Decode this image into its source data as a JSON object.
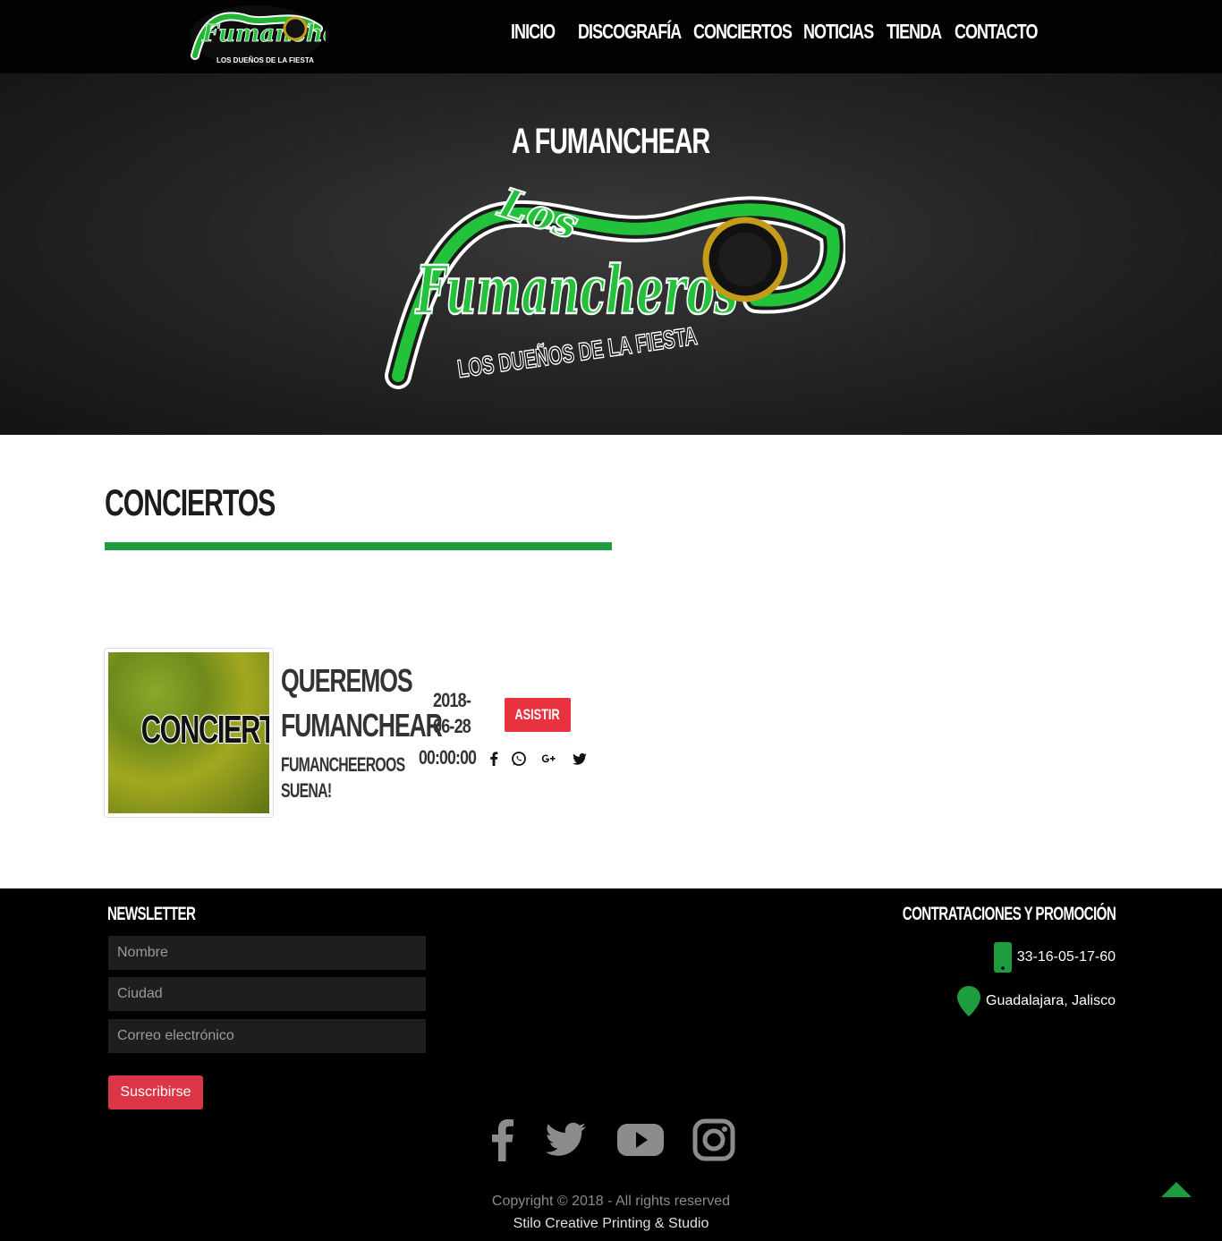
{
  "nav": {
    "items": [
      {
        "label": "INICIO"
      },
      {
        "label": "DISCOGRAFÍA"
      },
      {
        "label": "CONCIERTOS"
      },
      {
        "label": "NOTICIAS"
      },
      {
        "label": "TIENDA"
      },
      {
        "label": "CONTACTO"
      }
    ]
  },
  "brand": {
    "logo_line1": "Los",
    "logo_line2": "Fumancheros",
    "tagline": "LOS DUEÑOS DE LA FIESTA"
  },
  "hero": {
    "title": "A FUMANCHEAR"
  },
  "section": {
    "title": "CONCIERTOS"
  },
  "concert": {
    "thumb_label": "CONCIERTO",
    "title_line1": "QUEREMOS",
    "title_line2": "FUMANCHEAR",
    "subtitle_line1": "FUMANCHEEROOS",
    "subtitle_line2": "SUENA!",
    "date_line1": "2018-",
    "date_line2": "06-28",
    "time": "00:00:00",
    "button": "ASISTIR",
    "share_icons": [
      "facebook-icon",
      "whatsapp-icon",
      "google-plus-icon",
      "twitter-icon"
    ]
  },
  "footer": {
    "newsletter_heading": "NEWSLETTER",
    "name_placeholder": "Nombre",
    "city_placeholder": "Ciudad",
    "email_placeholder": "Correo electrónico",
    "subscribe": "Suscribirse",
    "contact_heading": "CONTRATACIONES Y PROMOCIÓN",
    "phone": "33-16-05-17-60",
    "location": "Guadalajara, Jalisco",
    "social_icons": [
      "facebook-icon",
      "twitter-icon",
      "youtube-icon",
      "instagram-icon"
    ],
    "copyright": "Copyright © 2018 - All rights reserved",
    "credit": "Stilo Creative Printing & Studio"
  },
  "colors": {
    "brand_green": "#1f9c3d",
    "button_red": "#e8333f",
    "footer_bg": "#000000",
    "nav_bg": "#020202"
  }
}
